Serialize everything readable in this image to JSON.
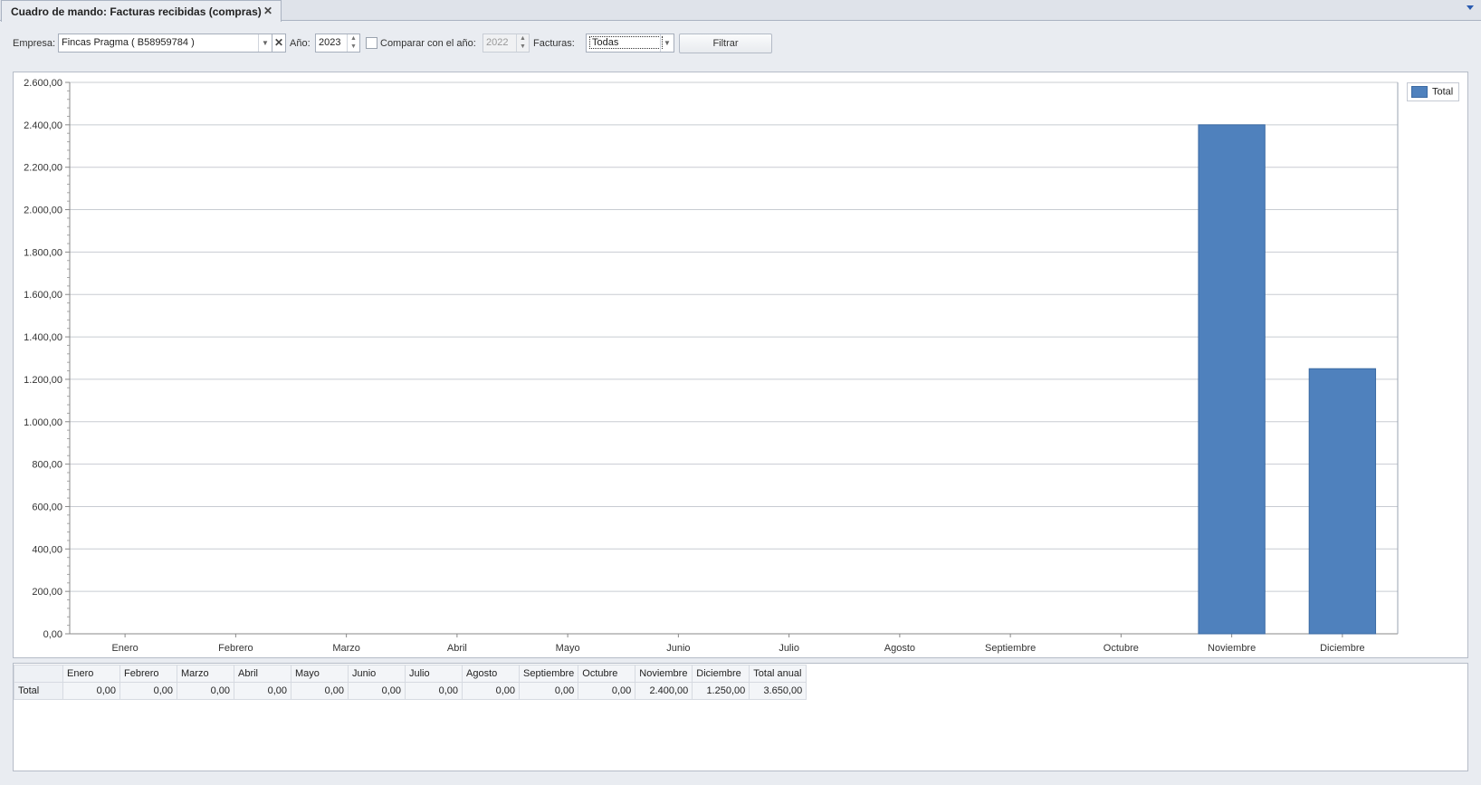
{
  "tab": {
    "title": "Cuadro de mando: Facturas recibidas (compras)",
    "close": "✕"
  },
  "toolbar": {
    "empresa_label": "Empresa:",
    "empresa_value": "Fincas Pragma ( B58959784 )",
    "ano_label": "Año:",
    "ano_value": "2023",
    "compare_label": "Comparar con el año:",
    "compare_checked": false,
    "compare_value": "2022",
    "facturas_label": "Facturas:",
    "facturas_value": "Todas",
    "filtrar_label": "Filtrar"
  },
  "chart_data": {
    "type": "bar",
    "categories": [
      "Enero",
      "Febrero",
      "Marzo",
      "Abril",
      "Mayo",
      "Junio",
      "Julio",
      "Agosto",
      "Septiembre",
      "Octubre",
      "Noviembre",
      "Diciembre"
    ],
    "series": [
      {
        "name": "Total",
        "color": "#4f81bd",
        "values": [
          0,
          0,
          0,
          0,
          0,
          0,
          0,
          0,
          0,
          0,
          2400,
          1250
        ]
      }
    ],
    "ylim": [
      0,
      2600
    ],
    "yticks": [
      "0,00",
      "200,00",
      "400,00",
      "600,00",
      "800,00",
      "1.000,00",
      "1.200,00",
      "1.400,00",
      "1.600,00",
      "1.800,00",
      "2.000,00",
      "2.200,00",
      "2.400,00",
      "2.600,00"
    ],
    "legend": "top-right",
    "grid": true
  },
  "table": {
    "headers": [
      "Enero",
      "Febrero",
      "Marzo",
      "Abril",
      "Mayo",
      "Junio",
      "Julio",
      "Agosto",
      "Septiembre",
      "Octubre",
      "Noviembre",
      "Diciembre",
      "Total anual"
    ],
    "rows": [
      {
        "label": "Total",
        "values": [
          "0,00",
          "0,00",
          "0,00",
          "0,00",
          "0,00",
          "0,00",
          "0,00",
          "0,00",
          "0,00",
          "0,00",
          "2.400,00",
          "1.250,00",
          "3.650,00"
        ]
      }
    ]
  }
}
